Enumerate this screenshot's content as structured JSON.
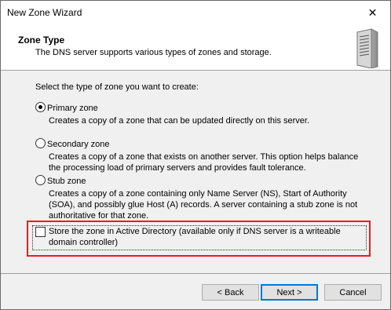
{
  "window": {
    "title": "New Zone Wizard",
    "close_glyph": "✕"
  },
  "header": {
    "title": "Zone Type",
    "subtitle": "The DNS server supports various types of zones and storage.",
    "icon": "server-tower-icon"
  },
  "prompt": "Select the type of zone you want to create:",
  "options": [
    {
      "label": "Primary zone",
      "selected": true,
      "description": "Creates a copy of a zone that can be updated directly on this server."
    },
    {
      "label": "Secondary zone",
      "selected": false,
      "description": "Creates a copy of a zone that exists on another server. This option helps balance the processing load of primary servers and provides fault tolerance."
    },
    {
      "label": "Stub zone",
      "selected": false,
      "description": "Creates a copy of a zone containing only Name Server (NS), Start of Authority (SOA), and possibly glue Host (A) records. A server containing a stub zone is not authoritative for that zone."
    }
  ],
  "ad_store": {
    "label": "Store the zone in Active Directory (available only if DNS server is a writeable domain controller)",
    "checked": false,
    "highlight_color": "#e02020"
  },
  "buttons": {
    "back": "< Back",
    "next": "Next >",
    "cancel": "Cancel"
  }
}
